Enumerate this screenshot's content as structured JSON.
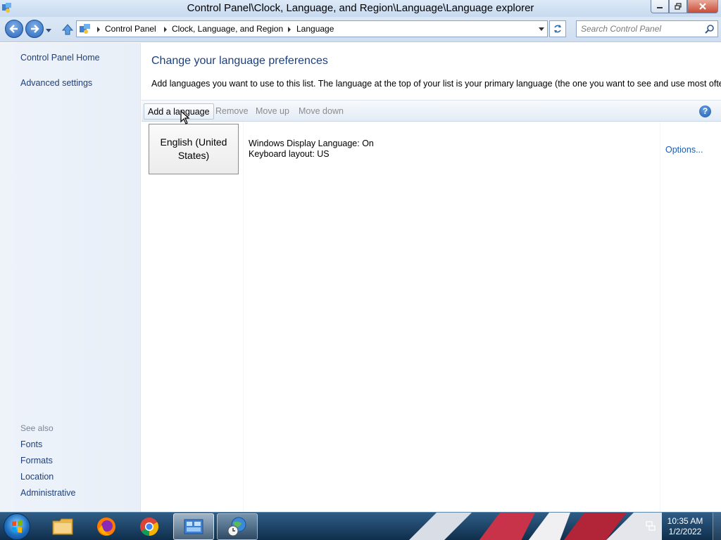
{
  "window": {
    "title": "Control Panel\\Clock, Language, and Region\\Language\\Language explorer"
  },
  "address_bar": {
    "breadcrumbs": [
      "Control Panel",
      "Clock, Language, and Region",
      "Language"
    ]
  },
  "search": {
    "placeholder": "Search Control Panel"
  },
  "sidebar": {
    "home": "Control Panel Home",
    "advanced": "Advanced settings",
    "see_also_heading": "See also",
    "see_also_items": [
      "Fonts",
      "Formats",
      "Location",
      "Administrative"
    ]
  },
  "main": {
    "title": "Change your language preferences",
    "description": "Add languages you want to use to this list. The language at the top of your list is your primary language (the one you want to see and use most often)."
  },
  "toolbar": {
    "add_label": "Add a language",
    "remove_label": "Remove",
    "move_up_label": "Move up",
    "move_down_label": "Move down",
    "help_label": "?"
  },
  "languages": [
    {
      "name": "English (United States)",
      "display_language": "Windows Display Language: On",
      "keyboard": "Keyboard layout: US",
      "options_label": "Options..."
    }
  ],
  "taskbar": {
    "items": [
      "start-button",
      "file-explorer",
      "firefox",
      "chrome",
      "control-panel",
      "language-clock-app"
    ],
    "time": "10:35 AM",
    "date": "1/2/2022"
  },
  "colors": {
    "link": "#1e3f7a",
    "accent_link": "#1e5bb0",
    "disabled_text": "#8c8c8c"
  }
}
